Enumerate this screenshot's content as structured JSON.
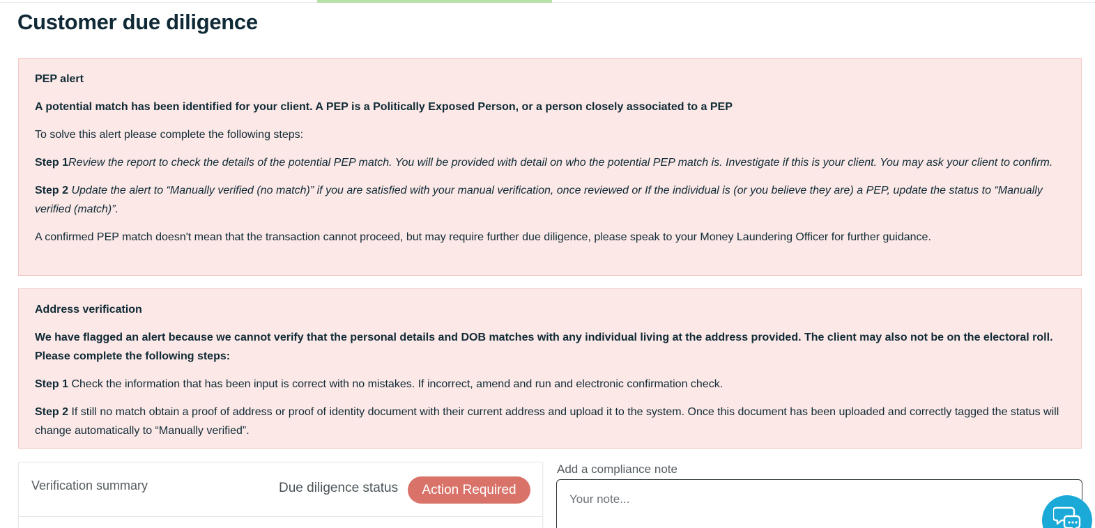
{
  "page": {
    "title": "Customer due diligence"
  },
  "pep_alert": {
    "title": "PEP alert",
    "lead": "A potential match has been identified for your client. A PEP is a Politically Exposed Person, or a person closely associated to a PEP",
    "intro": "To solve this alert please complete the following steps:",
    "step1_label": "Step 1",
    "step1_text": "Review the report to check the details of the potential PEP match. You will be provided with detail on who the potential PEP match is. Investigate if this is your client. You may ask your client to confirm.",
    "step2_label": "Step 2",
    "step2_text": "Update the alert to “Manually verified (no match)” if you are satisfied with your manual verification, once reviewed or If the individual is (or you believe they are) a PEP, update the status to “Manually verified (match)”.",
    "footer": "A confirmed PEP match doesn't mean that the transaction cannot proceed, but may require further due diligence, please speak to your Money Laundering Officer for further guidance."
  },
  "address_alert": {
    "title": "Address verification",
    "lead": "We have flagged an alert because we cannot verify that the personal details and DOB matches with any individual living at the address provided. The client may also not be on the electoral roll. Please complete the following steps:",
    "step1_label": "Step 1",
    "step1_text": "Check the information that has been input is correct with no mistakes. If incorrect, amend and run and electronic confirmation check.",
    "step2_label": "Step 2",
    "step2_text": "If still no match obtain a proof of address or proof of identity document with their current address and upload it to the system. Once this document has been uploaded and correctly tagged the status will change automatically to “Manually verified”."
  },
  "verification_summary": {
    "title": "Verification summary",
    "status_label": "Due diligence status",
    "status_value": "Action Required",
    "status_color": "#d9736a"
  },
  "compliance_note": {
    "label": "Add a compliance note",
    "placeholder": "Your note...",
    "value": ""
  },
  "chat": {
    "icon": "chat-bubbles-icon",
    "color": "#1ba9d8"
  },
  "colors": {
    "alert_background": "#fce8e6",
    "progress_accent": "#b8e0a8",
    "heading": "#0f2a36"
  }
}
